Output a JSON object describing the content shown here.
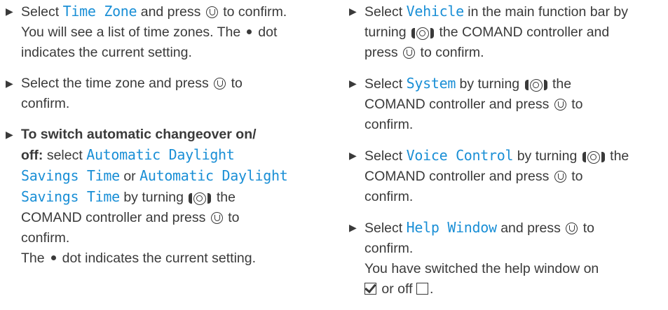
{
  "left_column": {
    "step1": {
      "select": "Select",
      "time_zone": "Time Zone",
      "and_press": "and press",
      "to_confirm_you_will_see": "to confirm.",
      "line2": "You will see a list of time zones. The",
      "dot_tail": "dot",
      "line3": "indicates the current setting."
    },
    "step2": {
      "text_a": "Select the time zone and press",
      "text_b": "to",
      "text_c": "confirm."
    },
    "step3": {
      "bold_a": "To switch automatic changeover on/",
      "bold_b": "off:",
      "select": "select",
      "option1_a": "Automatic Daylight",
      "option1_b": "Savings Time",
      "or": "or",
      "option2": "Automatic Daylight",
      "option2_b": "Savings Time",
      "by_turning": "by turning",
      "the": "the",
      "controller_line": "COMAND controller and press",
      "to": "to",
      "confirm": "confirm.",
      "the_line": "The",
      "dot_indicates": "dot indicates the current setting."
    }
  },
  "right_column": {
    "step1": {
      "select": "Select",
      "vehicle": "Vehicle",
      "main_bar": "in the main function bar by",
      "turning": "turning",
      "the_controller": "the COMAND controller and",
      "press": "press",
      "to_confirm": "to confirm."
    },
    "step2": {
      "select": "Select",
      "system": "System",
      "by_turning": "by turning",
      "the": "the",
      "controller_line": "COMAND controller and press",
      "to": "to",
      "confirm": "confirm."
    },
    "step3": {
      "select": "Select",
      "voice_control": "Voice Control",
      "by_turning": "by turning",
      "the": "the",
      "controller_line": "COMAND controller and press",
      "to": "to",
      "confirm": "confirm."
    },
    "step4": {
      "select": "Select",
      "help_window": "Help Window",
      "and_press": "and press",
      "to": "to",
      "confirm": "confirm.",
      "result_line": "You have switched the help window on",
      "or_off": "or off",
      "period": "."
    }
  },
  "colors": {
    "accent_monospace": "#1a8fd6",
    "text": "#3a3a3a"
  },
  "icons": [
    "arrow-bullet-icon",
    "press-controller-icon",
    "turn-controller-icon",
    "selection-dot-icon",
    "checkbox-checked-icon",
    "checkbox-empty-icon"
  ]
}
